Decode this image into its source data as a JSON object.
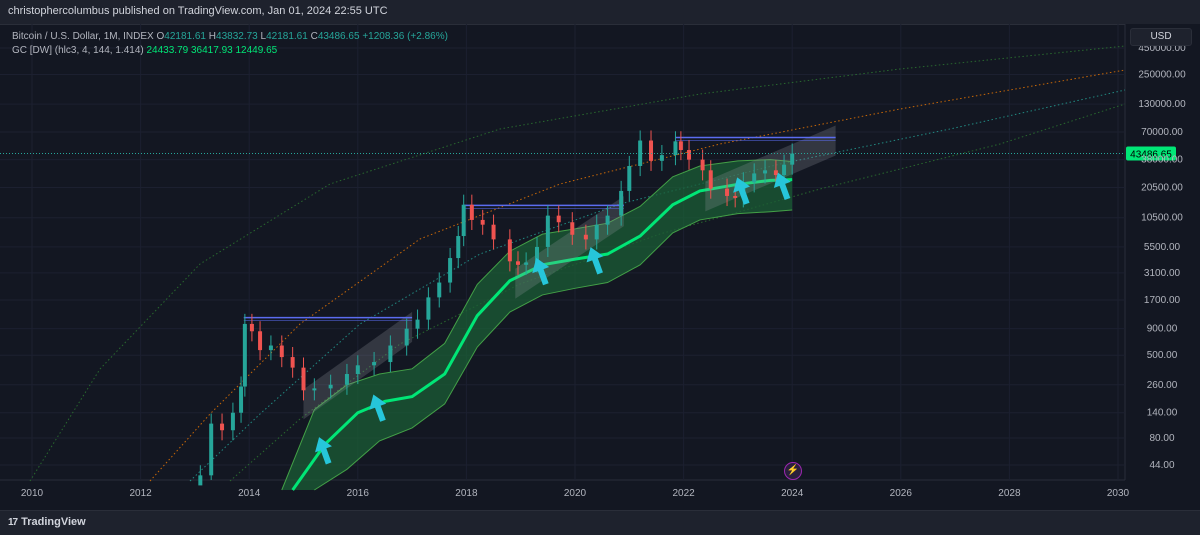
{
  "header": {
    "publish_line": "christophercolumbus published on TradingView.com, Jan 01, 2024 22:55 UTC"
  },
  "legend": {
    "symbol": "Bitcoin / U.S. Dollar, 1M, INDEX",
    "open_label": "O",
    "open": "42181.61",
    "high_label": "H",
    "high": "43832.73",
    "low_label": "L",
    "low": "42181.61",
    "close_label": "C",
    "close": "43486.65",
    "change": "+1208.36 (+2.86%)",
    "indicator": "GC [DW] (hlc3, 4, 144, 1.414)",
    "ind_v1": "24433.79",
    "ind_v2": "36417.93",
    "ind_v3": "12449.65"
  },
  "currency_button": "USD",
  "price_tag": "43486.65",
  "footer": {
    "brand": "TradingView",
    "brand_mark": "17"
  },
  "colors": {
    "background": "#131722",
    "up": "#26a69a",
    "down": "#ef5350",
    "band_fill": "#1b5e35",
    "band_center": "#00e676",
    "arrow": "#26c6da",
    "resistance": "#5b6cf0",
    "orange_curve": "#f57c00",
    "price_tag_bg": "#00e676"
  },
  "chart_data": {
    "type": "line",
    "y_scale": "log",
    "y_ticks": [
      "44.00",
      "80.00",
      "140.00",
      "260.00",
      "500.00",
      "900.00",
      "1700.00",
      "3100.00",
      "5500.00",
      "10500.00",
      "20500.00",
      "38000.00",
      "70000.00",
      "130000.00",
      "250000.00",
      "450000.00"
    ],
    "x_ticks": [
      "2010",
      "2012",
      "2014",
      "2016",
      "2018",
      "2020",
      "2022",
      "2024",
      "2026",
      "2028",
      "2030"
    ],
    "series": [
      {
        "type": "candlestick-approx",
        "points": [
          [
            2013.1,
            35
          ],
          [
            2013.3,
            110
          ],
          [
            2013.5,
            95
          ],
          [
            2013.7,
            140
          ],
          [
            2013.85,
            250
          ],
          [
            2013.92,
            1000
          ],
          [
            2014.05,
            850
          ],
          [
            2014.2,
            560
          ],
          [
            2014.4,
            620
          ],
          [
            2014.6,
            480
          ],
          [
            2014.8,
            380
          ],
          [
            2015.0,
            230
          ],
          [
            2015.2,
            240
          ],
          [
            2015.5,
            260
          ],
          [
            2015.8,
            330
          ],
          [
            2016.0,
            400
          ],
          [
            2016.3,
            430
          ],
          [
            2016.6,
            620
          ],
          [
            2016.9,
            900
          ],
          [
            2017.1,
            1100
          ],
          [
            2017.3,
            1800
          ],
          [
            2017.5,
            2500
          ],
          [
            2017.7,
            4300
          ],
          [
            2017.85,
            7000
          ],
          [
            2017.95,
            14000
          ],
          [
            2018.1,
            10000
          ],
          [
            2018.3,
            9000
          ],
          [
            2018.5,
            6500
          ],
          [
            2018.8,
            4000
          ],
          [
            2018.95,
            3700
          ],
          [
            2019.1,
            3900
          ],
          [
            2019.3,
            5500
          ],
          [
            2019.5,
            11000
          ],
          [
            2019.7,
            9500
          ],
          [
            2019.95,
            7200
          ],
          [
            2020.2,
            6500
          ],
          [
            2020.4,
            9000
          ],
          [
            2020.6,
            11000
          ],
          [
            2020.85,
            19000
          ],
          [
            2021.0,
            33000
          ],
          [
            2021.2,
            58000
          ],
          [
            2021.4,
            37000
          ],
          [
            2021.6,
            42000
          ],
          [
            2021.85,
            57000
          ],
          [
            2021.95,
            47000
          ],
          [
            2022.1,
            38000
          ],
          [
            2022.35,
            30000
          ],
          [
            2022.5,
            20000
          ],
          [
            2022.8,
            17000
          ],
          [
            2022.95,
            16500
          ],
          [
            2023.1,
            23000
          ],
          [
            2023.3,
            28000
          ],
          [
            2023.5,
            30000
          ],
          [
            2023.7,
            27000
          ],
          [
            2023.85,
            34000
          ],
          [
            2024.0,
            43486.65
          ]
        ]
      }
    ],
    "resistance_lines": [
      {
        "x": [
          2013.9,
          2017.0
        ],
        "y": 1150
      },
      {
        "x": [
          2017.95,
          2020.9
        ],
        "y": 13800
      },
      {
        "x": [
          2021.85,
          2024.8
        ],
        "y": 62000
      }
    ],
    "band_center": [
      [
        2014.8,
        3
      ],
      [
        2015.4,
        70
      ],
      [
        2016.0,
        140
      ],
      [
        2016.5,
        180
      ],
      [
        2017.0,
        200
      ],
      [
        2017.6,
        330
      ],
      [
        2018.2,
        1200
      ],
      [
        2018.8,
        2600
      ],
      [
        2019.4,
        3700
      ],
      [
        2020.0,
        4200
      ],
      [
        2020.6,
        4700
      ],
      [
        2021.2,
        7000
      ],
      [
        2021.8,
        14000
      ],
      [
        2022.3,
        19000
      ],
      [
        2023.0,
        22000
      ],
      [
        2023.6,
        24000
      ],
      [
        2024.0,
        24433.79
      ]
    ],
    "band_upper": [
      [
        2014.6,
        3
      ],
      [
        2015.2,
        150
      ],
      [
        2015.8,
        260
      ],
      [
        2016.4,
        330
      ],
      [
        2017.0,
        370
      ],
      [
        2017.6,
        650
      ],
      [
        2018.2,
        2400
      ],
      [
        2018.8,
        5000
      ],
      [
        2019.4,
        7300
      ],
      [
        2020.0,
        8200
      ],
      [
        2020.6,
        9300
      ],
      [
        2021.2,
        13500
      ],
      [
        2021.8,
        26000
      ],
      [
        2022.3,
        33000
      ],
      [
        2023.0,
        37000
      ],
      [
        2023.6,
        38000
      ],
      [
        2024.0,
        36417.93
      ]
    ],
    "band_lower": [
      [
        2015.2,
        3
      ],
      [
        2015.8,
        40
      ],
      [
        2016.4,
        75
      ],
      [
        2017.0,
        100
      ],
      [
        2017.6,
        170
      ],
      [
        2018.2,
        600
      ],
      [
        2018.8,
        1300
      ],
      [
        2019.4,
        1900
      ],
      [
        2020.0,
        2200
      ],
      [
        2020.6,
        2500
      ],
      [
        2021.2,
        3700
      ],
      [
        2021.8,
        7500
      ],
      [
        2022.3,
        10000
      ],
      [
        2023.0,
        11500
      ],
      [
        2023.6,
        12000
      ],
      [
        2024.0,
        12449.65
      ]
    ],
    "arrows_x": [
      2015.4,
      2016.4,
      2019.4,
      2020.4,
      2023.1,
      2023.85
    ]
  }
}
